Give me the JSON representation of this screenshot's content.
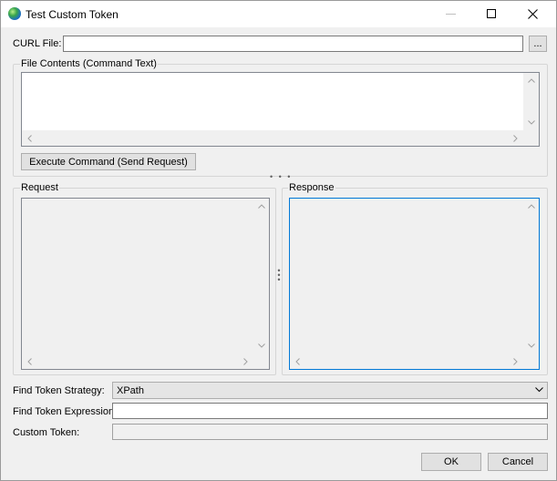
{
  "window": {
    "title": "Test Custom Token",
    "minimize_icon": "minimize-icon",
    "maximize_icon": "maximize-icon",
    "close_icon": "close-icon"
  },
  "curl": {
    "label": "CURL File:",
    "value": "",
    "browse_label": "..."
  },
  "file_contents": {
    "group_title": "File Contents (Command Text)",
    "text": "",
    "execute_label": "Execute Command (Send Request)"
  },
  "request": {
    "group_title": "Request",
    "text": ""
  },
  "response": {
    "group_title": "Response",
    "text": ""
  },
  "token": {
    "strategy_label": "Find Token Strategy:",
    "strategy_value": "XPath",
    "expression_label": "Find Token Expression:",
    "expression_value": "",
    "custom_label": "Custom Token:",
    "custom_value": ""
  },
  "buttons": {
    "ok": "OK",
    "cancel": "Cancel"
  },
  "colors": {
    "focus_border": "#0078d7",
    "window_bg": "#f0f0f0"
  }
}
